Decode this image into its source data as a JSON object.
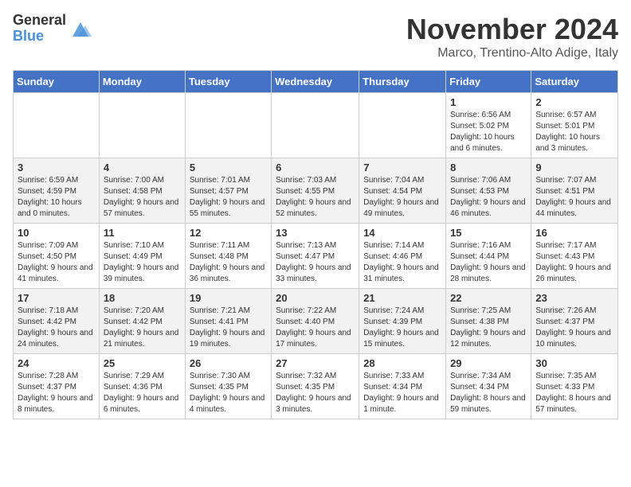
{
  "header": {
    "logo_general": "General",
    "logo_blue": "Blue",
    "month_title": "November 2024",
    "location": "Marco, Trentino-Alto Adige, Italy"
  },
  "days_of_week": [
    "Sunday",
    "Monday",
    "Tuesday",
    "Wednesday",
    "Thursday",
    "Friday",
    "Saturday"
  ],
  "weeks": [
    [
      {
        "day": "",
        "info": ""
      },
      {
        "day": "",
        "info": ""
      },
      {
        "day": "",
        "info": ""
      },
      {
        "day": "",
        "info": ""
      },
      {
        "day": "",
        "info": ""
      },
      {
        "day": "1",
        "info": "Sunrise: 6:56 AM\nSunset: 5:02 PM\nDaylight: 10 hours and 6 minutes."
      },
      {
        "day": "2",
        "info": "Sunrise: 6:57 AM\nSunset: 5:01 PM\nDaylight: 10 hours and 3 minutes."
      }
    ],
    [
      {
        "day": "3",
        "info": "Sunrise: 6:59 AM\nSunset: 4:59 PM\nDaylight: 10 hours and 0 minutes."
      },
      {
        "day": "4",
        "info": "Sunrise: 7:00 AM\nSunset: 4:58 PM\nDaylight: 9 hours and 57 minutes."
      },
      {
        "day": "5",
        "info": "Sunrise: 7:01 AM\nSunset: 4:57 PM\nDaylight: 9 hours and 55 minutes."
      },
      {
        "day": "6",
        "info": "Sunrise: 7:03 AM\nSunset: 4:55 PM\nDaylight: 9 hours and 52 minutes."
      },
      {
        "day": "7",
        "info": "Sunrise: 7:04 AM\nSunset: 4:54 PM\nDaylight: 9 hours and 49 minutes."
      },
      {
        "day": "8",
        "info": "Sunrise: 7:06 AM\nSunset: 4:53 PM\nDaylight: 9 hours and 46 minutes."
      },
      {
        "day": "9",
        "info": "Sunrise: 7:07 AM\nSunset: 4:51 PM\nDaylight: 9 hours and 44 minutes."
      }
    ],
    [
      {
        "day": "10",
        "info": "Sunrise: 7:09 AM\nSunset: 4:50 PM\nDaylight: 9 hours and 41 minutes."
      },
      {
        "day": "11",
        "info": "Sunrise: 7:10 AM\nSunset: 4:49 PM\nDaylight: 9 hours and 39 minutes."
      },
      {
        "day": "12",
        "info": "Sunrise: 7:11 AM\nSunset: 4:48 PM\nDaylight: 9 hours and 36 minutes."
      },
      {
        "day": "13",
        "info": "Sunrise: 7:13 AM\nSunset: 4:47 PM\nDaylight: 9 hours and 33 minutes."
      },
      {
        "day": "14",
        "info": "Sunrise: 7:14 AM\nSunset: 4:46 PM\nDaylight: 9 hours and 31 minutes."
      },
      {
        "day": "15",
        "info": "Sunrise: 7:16 AM\nSunset: 4:44 PM\nDaylight: 9 hours and 28 minutes."
      },
      {
        "day": "16",
        "info": "Sunrise: 7:17 AM\nSunset: 4:43 PM\nDaylight: 9 hours and 26 minutes."
      }
    ],
    [
      {
        "day": "17",
        "info": "Sunrise: 7:18 AM\nSunset: 4:42 PM\nDaylight: 9 hours and 24 minutes."
      },
      {
        "day": "18",
        "info": "Sunrise: 7:20 AM\nSunset: 4:42 PM\nDaylight: 9 hours and 21 minutes."
      },
      {
        "day": "19",
        "info": "Sunrise: 7:21 AM\nSunset: 4:41 PM\nDaylight: 9 hours and 19 minutes."
      },
      {
        "day": "20",
        "info": "Sunrise: 7:22 AM\nSunset: 4:40 PM\nDaylight: 9 hours and 17 minutes."
      },
      {
        "day": "21",
        "info": "Sunrise: 7:24 AM\nSunset: 4:39 PM\nDaylight: 9 hours and 15 minutes."
      },
      {
        "day": "22",
        "info": "Sunrise: 7:25 AM\nSunset: 4:38 PM\nDaylight: 9 hours and 12 minutes."
      },
      {
        "day": "23",
        "info": "Sunrise: 7:26 AM\nSunset: 4:37 PM\nDaylight: 9 hours and 10 minutes."
      }
    ],
    [
      {
        "day": "24",
        "info": "Sunrise: 7:28 AM\nSunset: 4:37 PM\nDaylight: 9 hours and 8 minutes."
      },
      {
        "day": "25",
        "info": "Sunrise: 7:29 AM\nSunset: 4:36 PM\nDaylight: 9 hours and 6 minutes."
      },
      {
        "day": "26",
        "info": "Sunrise: 7:30 AM\nSunset: 4:35 PM\nDaylight: 9 hours and 4 minutes."
      },
      {
        "day": "27",
        "info": "Sunrise: 7:32 AM\nSunset: 4:35 PM\nDaylight: 9 hours and 3 minutes."
      },
      {
        "day": "28",
        "info": "Sunrise: 7:33 AM\nSunset: 4:34 PM\nDaylight: 9 hours and 1 minute."
      },
      {
        "day": "29",
        "info": "Sunrise: 7:34 AM\nSunset: 4:34 PM\nDaylight: 8 hours and 59 minutes."
      },
      {
        "day": "30",
        "info": "Sunrise: 7:35 AM\nSunset: 4:33 PM\nDaylight: 8 hours and 57 minutes."
      }
    ]
  ]
}
